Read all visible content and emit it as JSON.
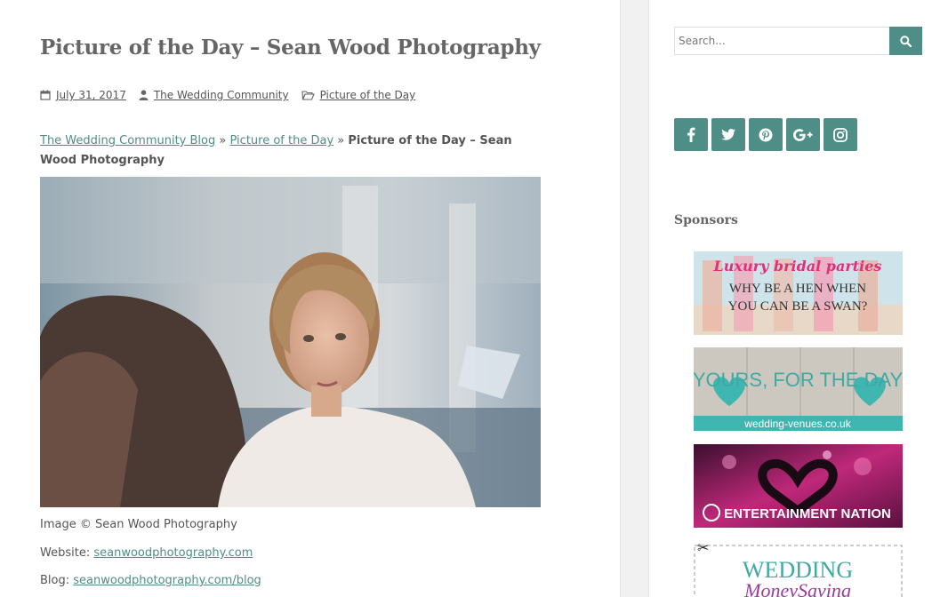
{
  "post": {
    "title": "Picture of the Day – Sean Wood Photography",
    "date": "July 31, 2017",
    "author": "The Wedding Community",
    "category": "Picture of the Day"
  },
  "breadcrumb": {
    "home": "The Wedding Community Blog",
    "separator": "»",
    "category": "Picture of the Day",
    "current": "Picture of the Day – Sean Wood Photography"
  },
  "caption": {
    "credit": "Image © Sean Wood Photography",
    "website_label": "Website:",
    "website_link": "seanwoodphotography.com",
    "blog_label": "Blog:",
    "blog_link": "seanwoodphotography.com/blog"
  },
  "sidebar": {
    "search_placeholder": "Search...",
    "social": [
      "facebook",
      "twitter",
      "pinterest",
      "google-plus",
      "instagram"
    ],
    "sponsors_title": "Sponsors",
    "ads": [
      {
        "line1": "Luxury bridal parties",
        "line2": "WHY BE A HEN WHEN",
        "line3": "YOU CAN BE A SWAN?"
      },
      {
        "line1": "YOURS, FOR THE DAY",
        "line2": "wedding-venues.co.uk"
      },
      {
        "line1": "ENTERTAINMENT NATION"
      },
      {
        "line1": "WEDDING",
        "line2": "MoneySaving"
      }
    ]
  },
  "colors": {
    "accent": "#4f8d87",
    "text": "#555555",
    "title": "#666666"
  }
}
